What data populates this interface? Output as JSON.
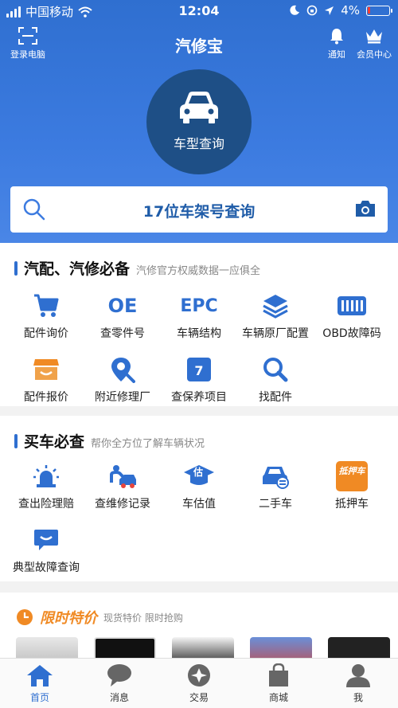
{
  "status_bar": {
    "carrier": "中国移动",
    "time": "12:04",
    "battery": "4%"
  },
  "nav": {
    "title": "汽修宝",
    "left_label": "登录电脑",
    "notify_label": "通知",
    "member_label": "会员中心"
  },
  "hero": {
    "car_query_label": "车型查询"
  },
  "vin_search": {
    "label": "17位车架号查询"
  },
  "section1": {
    "title": "汽配、汽修必备",
    "subtitle": "汽修官方权威数据一应俱全",
    "items": [
      {
        "label": "配件询价",
        "icon": "cart-icon"
      },
      {
        "label": "查零件号",
        "icon": "oe-icon",
        "glyph": "OE"
      },
      {
        "label": "车辆结构",
        "icon": "epc-icon",
        "glyph": "EPC"
      },
      {
        "label": "车辆原厂配置",
        "icon": "layers-icon"
      },
      {
        "label": "OBD故障码",
        "icon": "obd-icon"
      },
      {
        "label": "配件报价",
        "icon": "shop-icon"
      },
      {
        "label": "附近修理厂",
        "icon": "location-icon"
      },
      {
        "label": "查保养项目",
        "icon": "calendar-icon",
        "glyph": "7"
      },
      {
        "label": "找配件",
        "icon": "magnifier-icon"
      }
    ]
  },
  "section2": {
    "title": "买车必查",
    "subtitle": "帮你全方位了解车辆状况",
    "items": [
      {
        "label": "查出险理赔",
        "icon": "alarm-icon"
      },
      {
        "label": "查维修记录",
        "icon": "repair-icon"
      },
      {
        "label": "车估值",
        "icon": "valuation-icon",
        "glyph": "估"
      },
      {
        "label": "二手车",
        "icon": "used-car-icon"
      },
      {
        "label": "抵押车",
        "icon": "mortgage-icon",
        "glyph": "抵押车"
      },
      {
        "label": "典型故障查询",
        "icon": "chat-icon"
      }
    ]
  },
  "special": {
    "title": "限时特价",
    "subtitle": "现货特价 限时抢购"
  },
  "tabs": [
    {
      "label": "首页",
      "icon": "home-icon",
      "active": true
    },
    {
      "label": "消息",
      "icon": "message-icon",
      "active": false
    },
    {
      "label": "交易",
      "icon": "trade-icon",
      "active": false
    },
    {
      "label": "商城",
      "icon": "mall-icon",
      "active": false
    },
    {
      "label": "我",
      "icon": "profile-icon",
      "active": false
    }
  ],
  "colors": {
    "primary": "#2f6fd0",
    "dark_circle": "#1e4f86",
    "orange": "#f08a24"
  }
}
